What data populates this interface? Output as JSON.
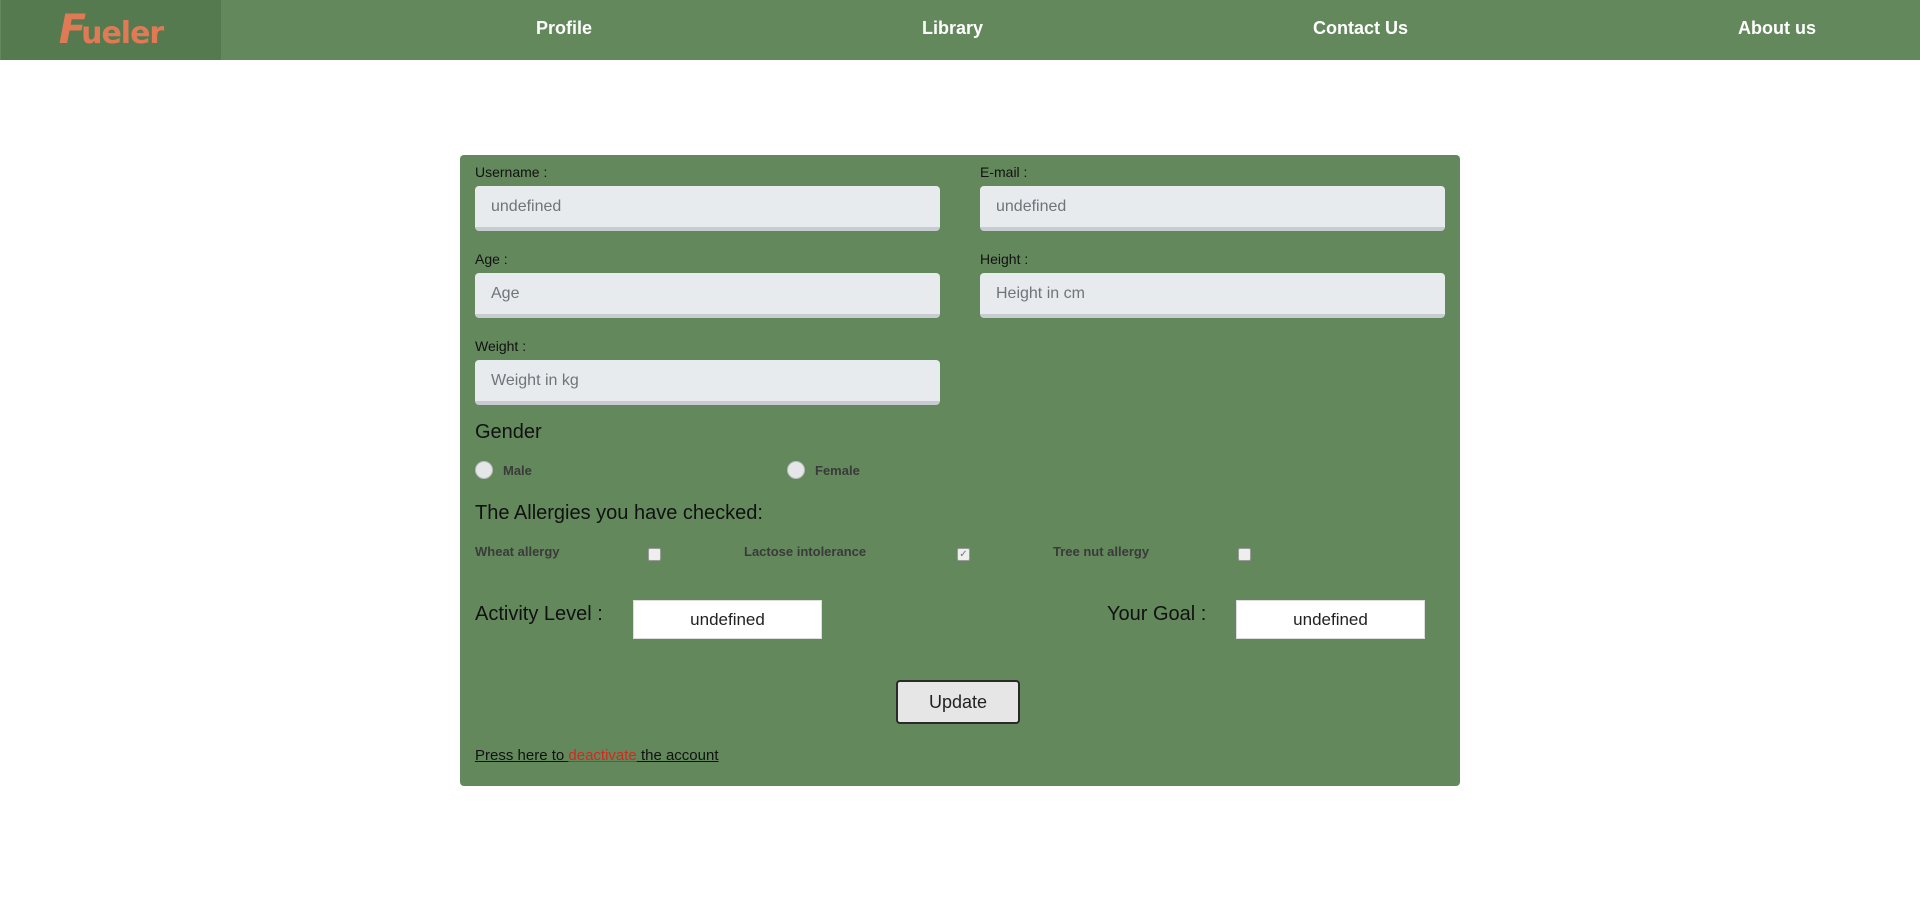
{
  "nav": {
    "logo_initial": "F",
    "logo_rest": "ueler",
    "links": [
      "Profile",
      "Library",
      "Contact Us",
      "About us"
    ]
  },
  "form": {
    "username": {
      "label": "Username :",
      "value": "undefined"
    },
    "email": {
      "label": "E-mail :",
      "value": "undefined"
    },
    "age": {
      "label": "Age :",
      "placeholder": "Age"
    },
    "height": {
      "label": "Height :",
      "placeholder": "Height in cm"
    },
    "weight": {
      "label": "Weight :",
      "placeholder": "Weight in kg"
    }
  },
  "gender": {
    "heading": "Gender",
    "options": [
      "Male",
      "Female"
    ]
  },
  "allergies": {
    "heading": "The Allergies you have checked:",
    "items": [
      {
        "label": "Wheat allergy",
        "checked": false
      },
      {
        "label": "Lactose intolerance",
        "checked": true
      },
      {
        "label": "Tree nut allergy",
        "checked": false
      }
    ]
  },
  "activity": {
    "label": "Activity Level :",
    "value": "undefined"
  },
  "goal": {
    "label": "Your Goal :",
    "value": "undefined"
  },
  "update_label": "Update",
  "deactivate": {
    "prefix": "Press here to ",
    "link": "deactivate",
    "suffix": " the account"
  },
  "colors": {
    "nav_bg": "#63885c",
    "logo_bg": "#557a50",
    "logo_text": "#e07a55",
    "card_bg": "#63885c",
    "link_red": "#d9261c"
  }
}
